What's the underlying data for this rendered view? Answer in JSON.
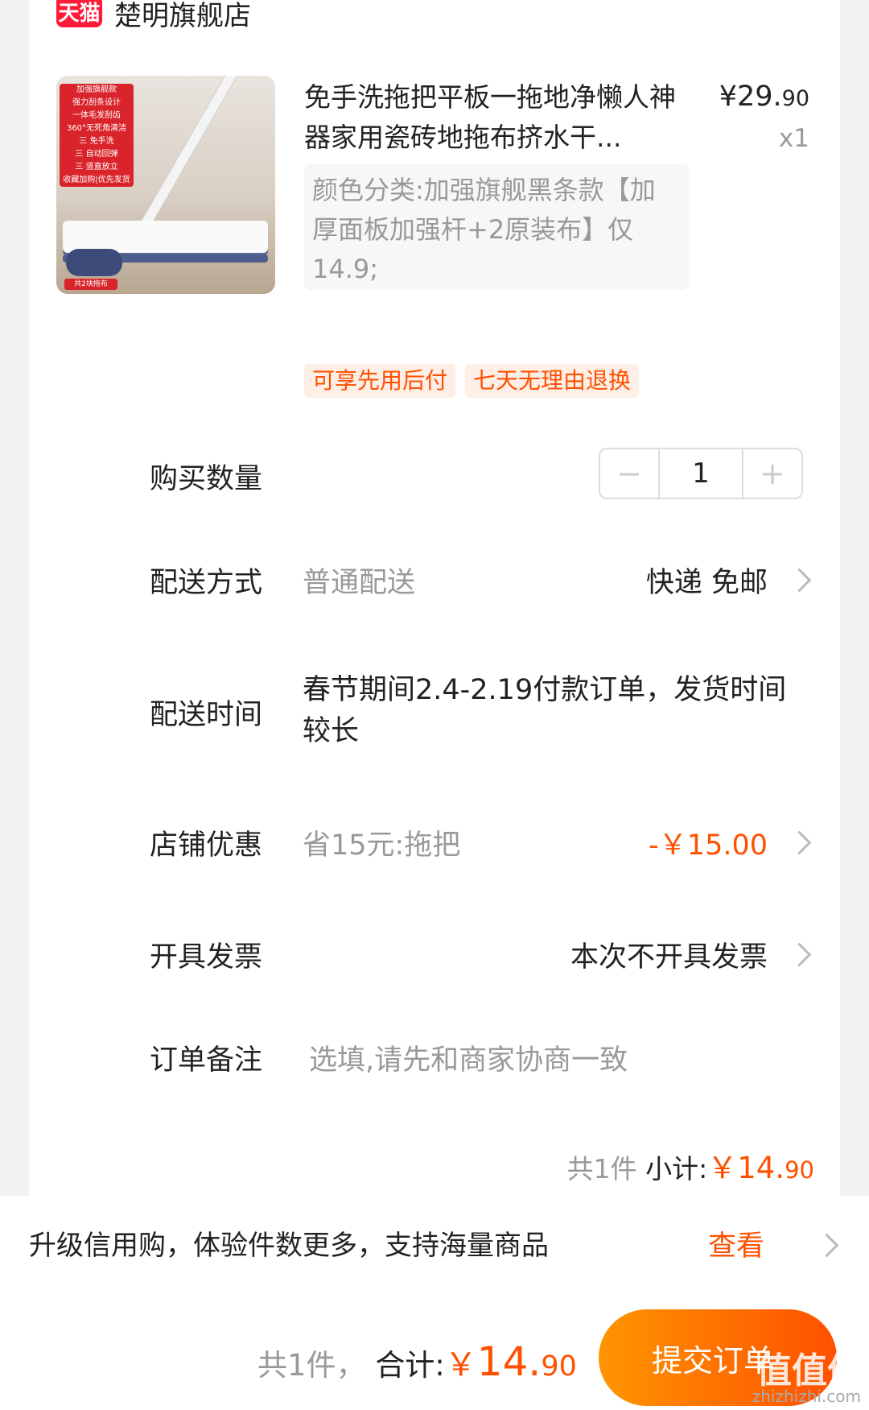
{
  "store": {
    "badge": "天猫",
    "name": "楚明旗舰店"
  },
  "product": {
    "title": "免手洗拖把平板一拖地净懒人神器家用瓷砖地拖布挤水干...",
    "price_int": "¥29.",
    "price_dec": "90",
    "qty_text": "x1",
    "variant": "颜色分类:加强旗舰黑条款【加厚面板加强杆+2原装布】仅14.9;",
    "image_banner": [
      "加强旗舰款",
      "强力刮条设计",
      "一体毛发刮齿",
      "360°无死角清洁",
      "三 免手洗",
      "三 自动回弹",
      "三 竖直放立",
      "收藏加购|优先发货"
    ],
    "image_tag": "共2块拖布"
  },
  "tags": [
    "可享先用后付",
    "七天无理由退换"
  ],
  "quantity": {
    "label": "购买数量",
    "minus": "−",
    "value": "1",
    "plus": "+"
  },
  "delivery_method": {
    "label": "配送方式",
    "value": "普通配送",
    "right": "快递 免邮"
  },
  "delivery_time": {
    "label": "配送时间",
    "value": "春节期间2.4-2.19付款订单，发货时间较长"
  },
  "store_discount": {
    "label": "店铺优惠",
    "value": "省15元:拖把",
    "right": "-￥15.00"
  },
  "invoice": {
    "label": "开具发票",
    "right": "本次不开具发票"
  },
  "note": {
    "label": "订单备注",
    "placeholder": "选填,请先和商家协商一致"
  },
  "subtotal": {
    "count": "共1件",
    "label": "小计:",
    "int": "￥14.",
    "dec": "90"
  },
  "credit": {
    "text": "升级信用购，体验件数更多，支持海量商品",
    "link": "查看"
  },
  "footer": {
    "count": "共1件，",
    "label": "合计:",
    "currency": "￥",
    "int": "14.",
    "dec": "90",
    "submit": "提交订单"
  },
  "watermark": {
    "text": "值值值",
    "url": "zhizhizhi.com"
  },
  "colors": {
    "accent": "#ff5000",
    "tmall": "#ff1b37",
    "tag_bg": "#fdeee6"
  }
}
